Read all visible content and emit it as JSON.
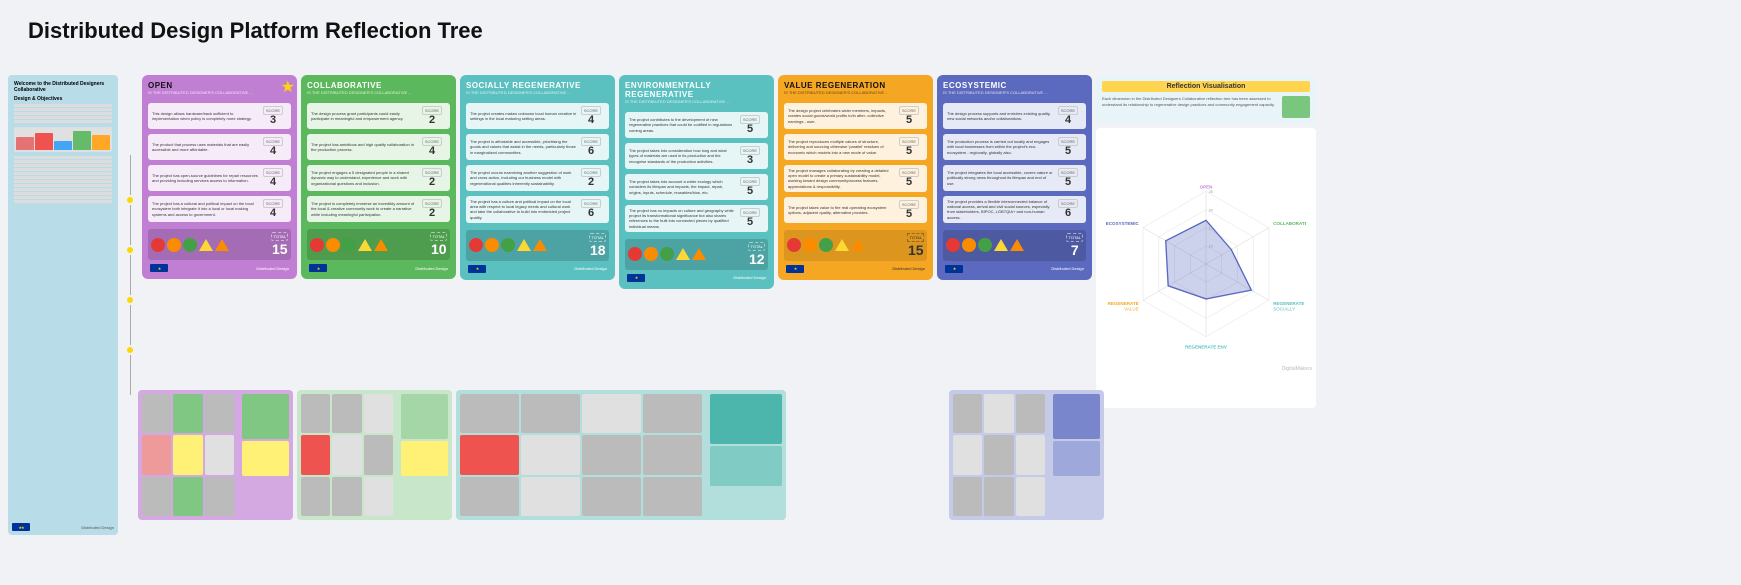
{
  "title": "Distributed Design Platform Reflection Tree",
  "leftPanel": {
    "welcomeTitle": "Welcome to the Distributed Designers Collaborative",
    "designObjectives": "Design & Objectives",
    "objectives": [
      "The design frames/back a tech sufficient to implementation when policy is completely more strategy.",
      "The product that process uses materials that are easily accelerate take affordable.",
      "The project has open-source guidelines for repair resources and fixing including access to the information.",
      "The project has a cultural and political impact on the local ecosystem both integrate it into a local or local making systems and various access to questions."
    ]
  },
  "cards": [
    {
      "id": "open",
      "title": "OPEN",
      "color": "#c17fd4",
      "subtitle": "IS THE DISTRIBUTED DESIGNER'S COLLABORATIVE ...",
      "star": true,
      "scores": [
        {
          "text": "This design allows hardware/back sufficient to implementation when policy is completely more strategy.",
          "score": "3"
        },
        {
          "text": "The product that process uses materials that are easily accessible and more affordable.",
          "score": "4"
        },
        {
          "text": "The project has open-source guidelines for repair resources and providing including services access to information.",
          "score": "4"
        },
        {
          "text": "The project has a cultural and political impact on the local ecosystem both integrate it into a local or local making systems and access to government.",
          "score": "4"
        }
      ],
      "total": "15",
      "shapes": [
        "red",
        "orange",
        "green",
        "triangle-yellow",
        "triangle-orange"
      ]
    },
    {
      "id": "collaborative",
      "title": "COLLABORATIVE",
      "color": "#5cb85c",
      "subtitle": "IS THE DISTRIBUTED DESIGNER'S COLLABORATIVE ...",
      "scores": [
        {
          "text": "The design process grant participants could easily participate in meaningful and empowerment agency.",
          "score": "2"
        },
        {
          "text": "The project has ambitious and high quality collaboration in the production process.",
          "score": "4"
        },
        {
          "text": "The project engages a 5 designated people in a shared dynamic way to understand, experience and work with organizational questions and inclusion.",
          "score": "2"
        },
        {
          "text": "The project is completely immerse an incredibly amount of the local & creative community work to create a narrative while including meaningful participation.",
          "score": "2"
        }
      ],
      "total": "10",
      "shapes": [
        "red",
        "orange",
        "green",
        "triangle-yellow",
        "triangle-orange"
      ]
    },
    {
      "id": "socially",
      "title": "SOCIALLY REGENERATIVE",
      "color": "#5bc0c0",
      "subtitle": "IS THE DISTRIBUTED DESIGNER'S COLLABORATIVE ...",
      "scores": [
        {
          "text": "The project creates makes unknown local human creative in settings in the local maturing setting areas.",
          "score": "4"
        },
        {
          "text": "The project is affordable and accessible, prioritising the goods and values that assist in the needs, particularly those in marginalized communities.",
          "score": "6"
        },
        {
          "text": "The project occurs examining another suggestion of work and cross action, including our business model with regenerational qualities inherently sustainability.",
          "score": "2"
        },
        {
          "text": "The project has a culture and political impact on the local area with respect to local legacy needs and cultural work and take the collaborative to build into embedded project quality.",
          "score": "6"
        }
      ],
      "total": "18",
      "shapes": [
        "red",
        "orange",
        "green",
        "triangle-yellow",
        "triangle-orange"
      ]
    },
    {
      "id": "environmentally",
      "title": "ENVIRONMENTALLY REGENERATIVE",
      "color": "#5bc0c0",
      "subtitle": "IS THE DISTRIBUTED DESIGNER'S COLLABORATIVE ...",
      "scores": [
        {
          "text": "The project contributes to the development of new regenerative practices that could be codified in regulations coming areas.",
          "score": "5"
        },
        {
          "text": "The project takes into consideration how long and what types of materials are used in its production and the recognise standards of the production activities.",
          "score": "3"
        },
        {
          "text": "The project takes into account a wider ecology which considers its lifespan and impacts, the impact, repair, origins, inputs, schedule, reusables/bios, etc.",
          "score": "5"
        },
        {
          "text": "The project has no impacts on culture and geography while project its transformational significance but also shares references to the built into connected pieces by qualified individual means.",
          "score": "5"
        }
      ],
      "total": "12",
      "shapes": [
        "red",
        "orange",
        "green",
        "triangle-yellow",
        "triangle-orange"
      ]
    },
    {
      "id": "value",
      "title": "VALUE REGENERATION",
      "color": "#f5a623",
      "subtitle": "IS THE DISTRIBUTED DESIGNER'S COLLABORATIVE ...",
      "scores": [
        {
          "text": "The design project celebrates wider members, impacts, creates social goods/world profits to/in after- collective earnings - user.",
          "score": "5"
        },
        {
          "text": "The project reproduces multiple values of structure, delivering and sourcing otherwise 'parallel' residues of economic which models into a new mode of value.",
          "score": "5"
        },
        {
          "text": "The project manages collaborating by creating a detailed open model to create a primary sustainability model, working toward design community/access features, appreciations & responsibility.",
          "score": "5"
        },
        {
          "text": "The project takes value to the real operating ecosystem options, adjacent quality, alternative provides.",
          "score": "5"
        }
      ],
      "total": "15",
      "shapes": [
        "red",
        "orange",
        "green",
        "triangle-yellow",
        "triangle-orange"
      ]
    },
    {
      "id": "ecosystemic",
      "title": "ECOSYSTEMIC",
      "color": "#5b6abf",
      "subtitle": "IS THE DISTRIBUTED DESIGNER'S COLLABORATIVE ...",
      "scores": [
        {
          "text": "The design process supports and enriches existing quality, new social networks and/or collaborations.",
          "score": "4"
        },
        {
          "text": "The production process is carried out locally and engages with local businesses from within the project's eco-ecosystem - regionally, globally also.",
          "score": "5"
        },
        {
          "text": "The project integrates the local accessible, covers nature or politically strong news throughout its lifespan and end of use.",
          "score": "5"
        },
        {
          "text": "The project provides a flexible interconnected balance of national access, arrival and civil social sources, especially from stakeholders, BIPOC, LGBTQIA+ and non-human access.",
          "score": "6"
        }
      ],
      "total": "7",
      "shapes": [
        "red",
        "orange",
        "green",
        "triangle-yellow",
        "triangle-orange"
      ]
    }
  ],
  "reflectionViz": {
    "title": "Reflection Visualisation",
    "description": "Each dimension in the Distributed Designers Collaborative reflection tree has been assessed to understand its relationship to regenerative design practices and community engagement capacity.",
    "radarLabels": {
      "open": "OPEN",
      "collaborate": "COLLABORATE",
      "regenSocially": "REGENERATE SOCIALLY",
      "regenEnvironmentally": "REGENERATE ENVIRONMENTALLY",
      "regenValue": "REGENERATE VALUE",
      "ecosystemic": "ECOSYSTEMIC"
    },
    "radarValues": {
      "open": 15,
      "collaborate": 10,
      "regenSocially": 18,
      "regenEnvironmentally": 12,
      "regenValue": 15,
      "ecosystemic": 16
    },
    "maxValue": 25
  },
  "scoreLabel": "SCORE",
  "totalLabel": "TOTAL"
}
